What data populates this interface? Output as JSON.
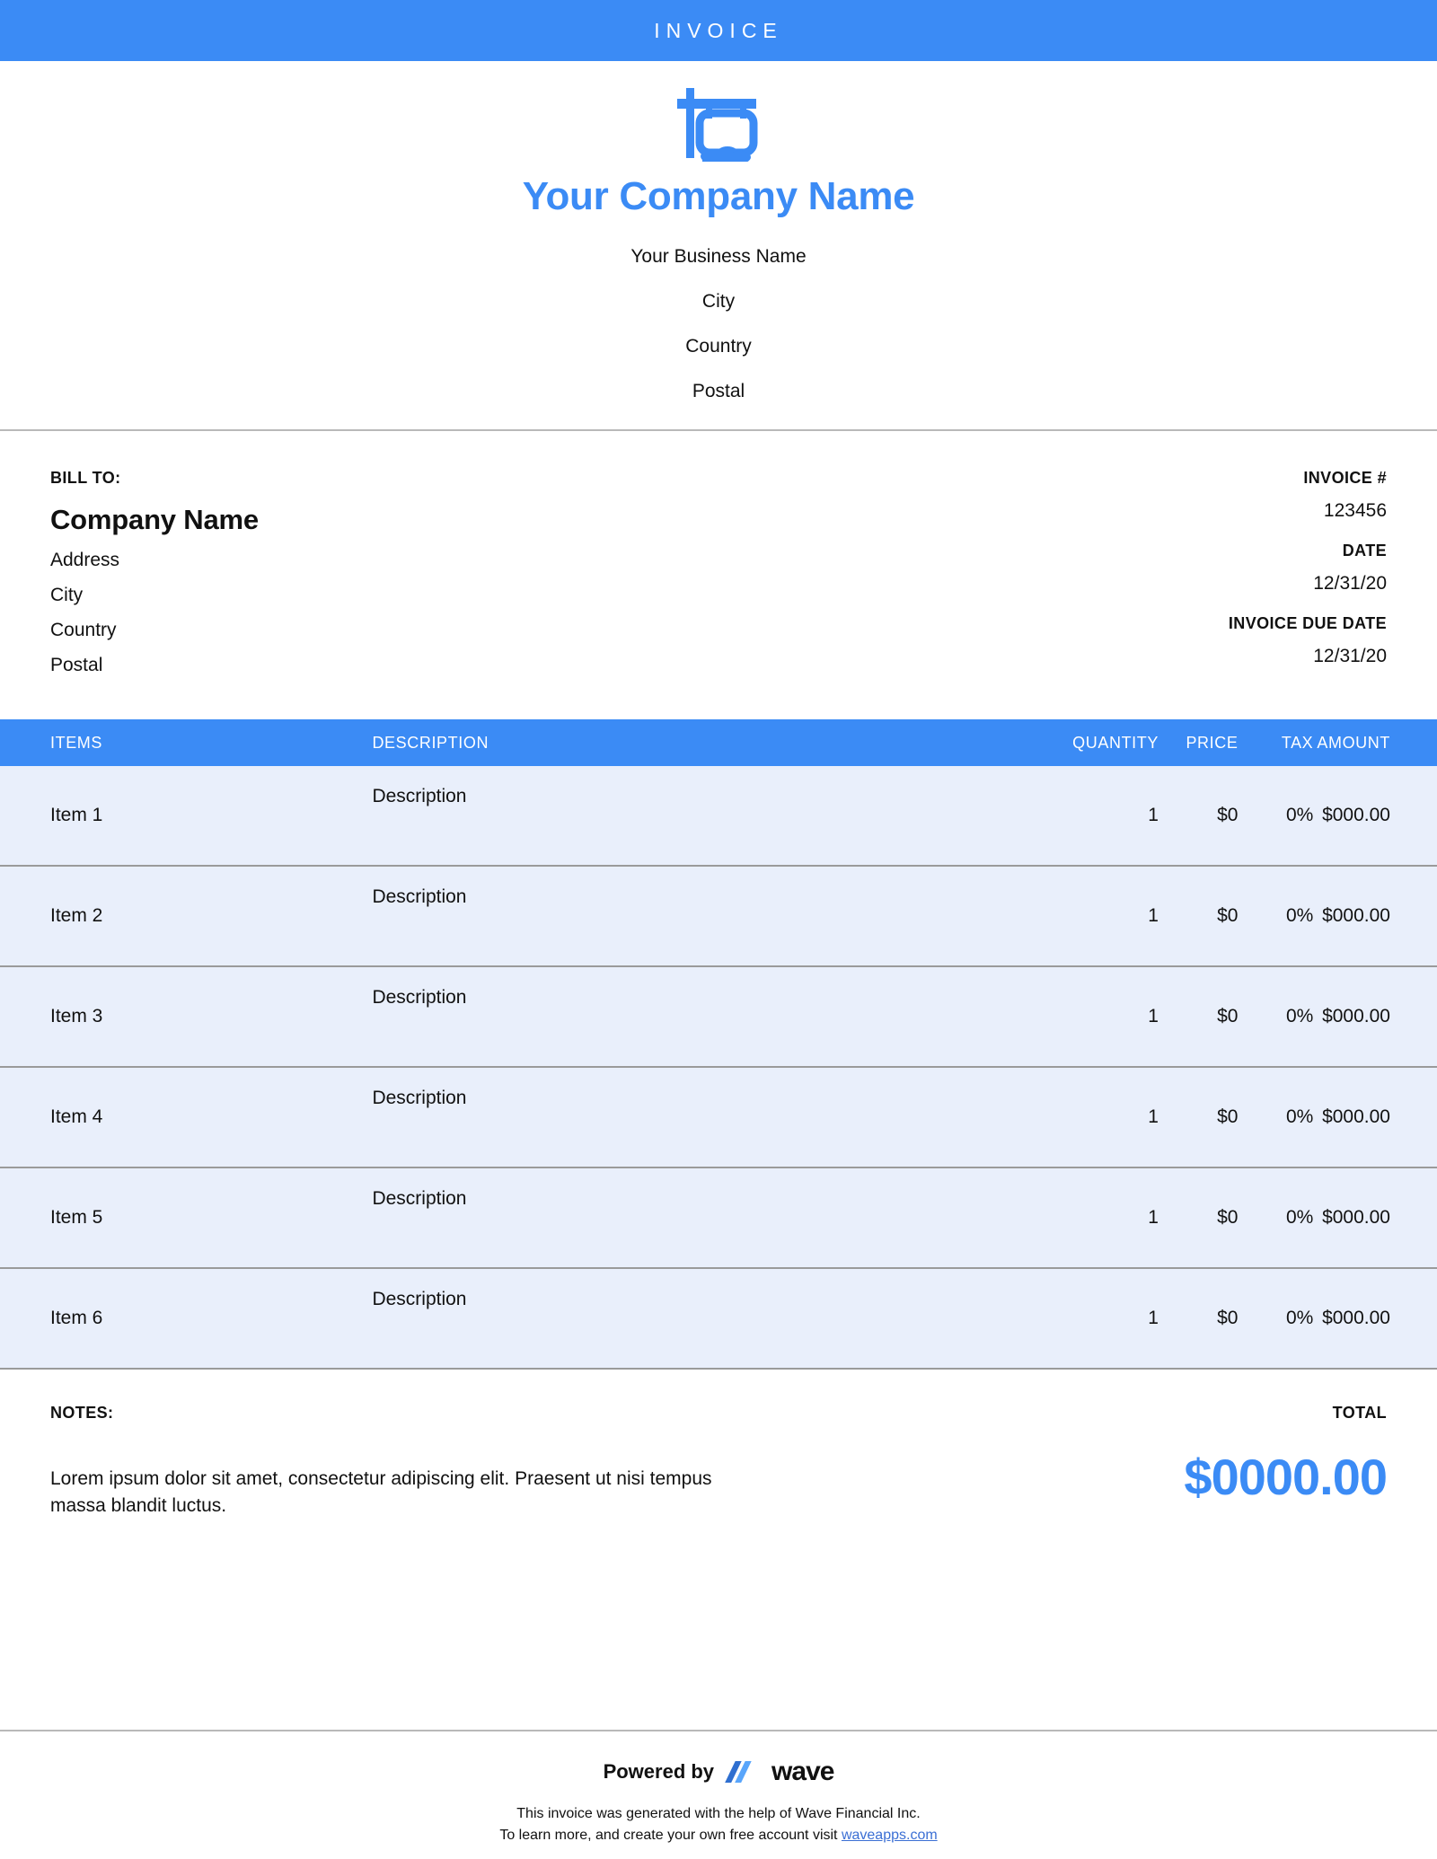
{
  "banner": {
    "title": "INVOICE"
  },
  "brand": {
    "logo_icon": "signpost-icon",
    "accent_color": "#3b8bf5",
    "company_name": "Your Company Name",
    "business_name": "Your Business Name",
    "city": "City",
    "country": "Country",
    "postal": "Postal"
  },
  "bill_to": {
    "label": "BILL TO:",
    "client_name": "Company Name",
    "address": "Address",
    "city": "City",
    "country": "Country",
    "postal": "Postal"
  },
  "invoice_meta": {
    "number_label": "INVOICE #",
    "number_value": "123456",
    "date_label": "DATE",
    "date_value": "12/31/20",
    "due_label": "INVOICE DUE DATE",
    "due_value": "12/31/20"
  },
  "table": {
    "headers": {
      "items": "ITEMS",
      "description": "DESCRIPTION",
      "quantity": "QUANTITY",
      "price": "PRICE",
      "tax": "TAX",
      "amount": "AMOUNT"
    },
    "rows": [
      {
        "item": "Item 1",
        "description": "Description",
        "quantity": "1",
        "price": "$0",
        "tax": "0%",
        "amount": "$000.00"
      },
      {
        "item": "Item 2",
        "description": "Description",
        "quantity": "1",
        "price": "$0",
        "tax": "0%",
        "amount": "$000.00"
      },
      {
        "item": "Item 3",
        "description": "Description",
        "quantity": "1",
        "price": "$0",
        "tax": "0%",
        "amount": "$000.00"
      },
      {
        "item": "Item 4",
        "description": "Description",
        "quantity": "1",
        "price": "$0",
        "tax": "0%",
        "amount": "$000.00"
      },
      {
        "item": "Item 5",
        "description": "Description",
        "quantity": "1",
        "price": "$0",
        "tax": "0%",
        "amount": "$000.00"
      },
      {
        "item": "Item 6",
        "description": "Description",
        "quantity": "1",
        "price": "$0",
        "tax": "0%",
        "amount": "$000.00"
      }
    ]
  },
  "notes": {
    "label": "NOTES:",
    "text": "Lorem ipsum dolor sit amet, consectetur adipiscing elit. Praesent ut nisi tempus massa blandit luctus."
  },
  "total": {
    "label": "TOTAL",
    "value": "$0000.00"
  },
  "footer": {
    "powered_by": "Powered by",
    "wave_wordmark": "wave",
    "wave_logo_icon": "wave-logo-icon",
    "line1": "This invoice was generated with the help of Wave Financial Inc.",
    "line2_prefix": "To learn more, and create your own free account visit ",
    "link_text": "waveapps.com"
  }
}
